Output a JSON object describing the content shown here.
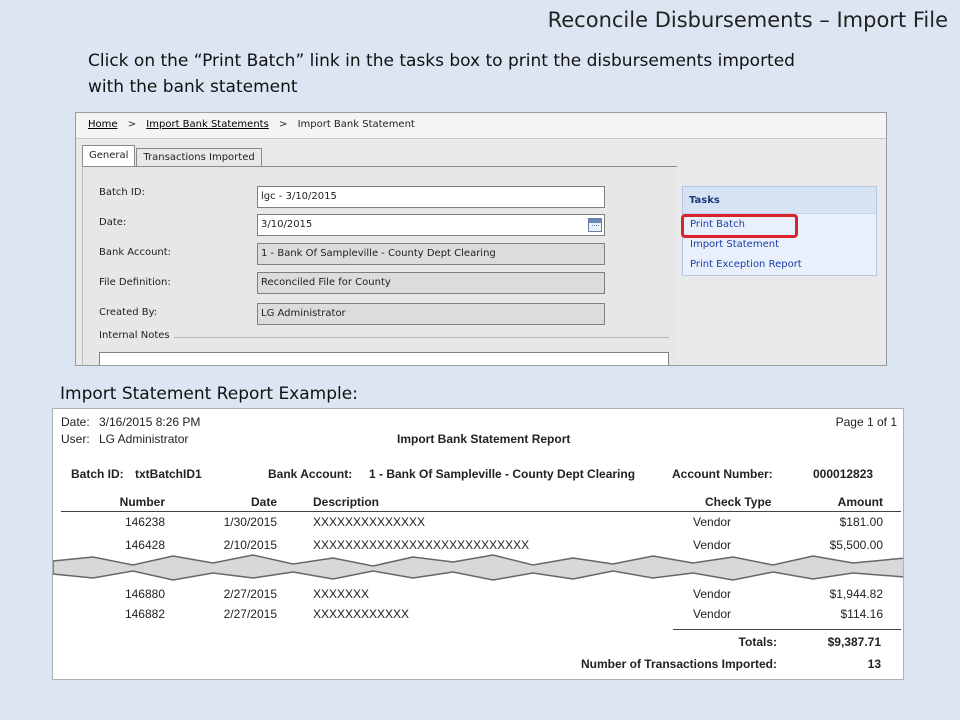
{
  "slide": {
    "title": "Reconcile Disbursements – Import File",
    "instruction": "Click on the “Print Batch” link in the tasks box to print the disbursements imported with the bank statement",
    "report_caption": "Import Statement Report Example:"
  },
  "app": {
    "breadcrumb": {
      "home": "Home",
      "import_bank_statements": "Import Bank Statements",
      "current": "Import Bank Statement",
      "separator": ">"
    },
    "tabs": [
      {
        "label": "General",
        "active": true
      },
      {
        "label": "Transactions Imported",
        "active": false
      }
    ],
    "fields": {
      "batch_id": {
        "label": "Batch ID:",
        "value": "lgc - 3/10/2015"
      },
      "date": {
        "label": "Date:",
        "value": "3/10/2015"
      },
      "bank_account": {
        "label": "Bank Account:",
        "value": "1 - Bank Of Sampleville - County Dept Clearing"
      },
      "file_definition": {
        "label": "File Definition:",
        "value": "Reconciled File for County"
      },
      "created_by": {
        "label": "Created By:",
        "value": "LG Administrator"
      }
    },
    "internal_notes_label": "Internal Notes",
    "tasks": {
      "header": "Tasks",
      "items": [
        "Print Batch",
        "Import Statement",
        "Print Exception Report"
      ],
      "highlighted": "Print Batch",
      "highlight_color": "#d8232a"
    }
  },
  "report": {
    "date_label": "Date:",
    "date_value": "3/16/2015 8:26 PM",
    "user_label": "User:",
    "user_value": "LG Administrator",
    "page": "Page 1 of 1",
    "title": "Import Bank Statement Report",
    "batch_id_label": "Batch ID:",
    "batch_id_value": "txtBatchID1",
    "bank_account_label": "Bank Account:",
    "bank_account_value": "1 - Bank Of Sampleville - County Dept Clearing",
    "account_number_label": "Account Number:",
    "account_number_value": "000012823",
    "columns": {
      "number": "Number",
      "date": "Date",
      "description": "Description",
      "check_type": "Check Type",
      "amount": "Amount"
    },
    "rows_top": [
      {
        "number": "146238",
        "date": "1/30/2015",
        "description": "XXXXXXXXXXXXXX",
        "check_type": "Vendor",
        "amount": "$181.00"
      },
      {
        "number": "146428",
        "date": "2/10/2015",
        "description": "XXXXXXXXXXXXXXXXXXXXXXXXXXX",
        "check_type": "Vendor",
        "amount": "$5,500.00"
      }
    ],
    "rows_bottom": [
      {
        "number": "146880",
        "date": "2/27/2015",
        "description": "XXXXXXX",
        "check_type": "Vendor",
        "amount": "$1,944.82"
      },
      {
        "number": "146882",
        "date": "2/27/2015",
        "description": "XXXXXXXXXXXX",
        "check_type": "Vendor",
        "amount": "$114.16"
      }
    ],
    "totals_label": "Totals:",
    "totals_value": "$9,387.71",
    "count_label": "Number of Transactions Imported:",
    "count_value": "13"
  }
}
